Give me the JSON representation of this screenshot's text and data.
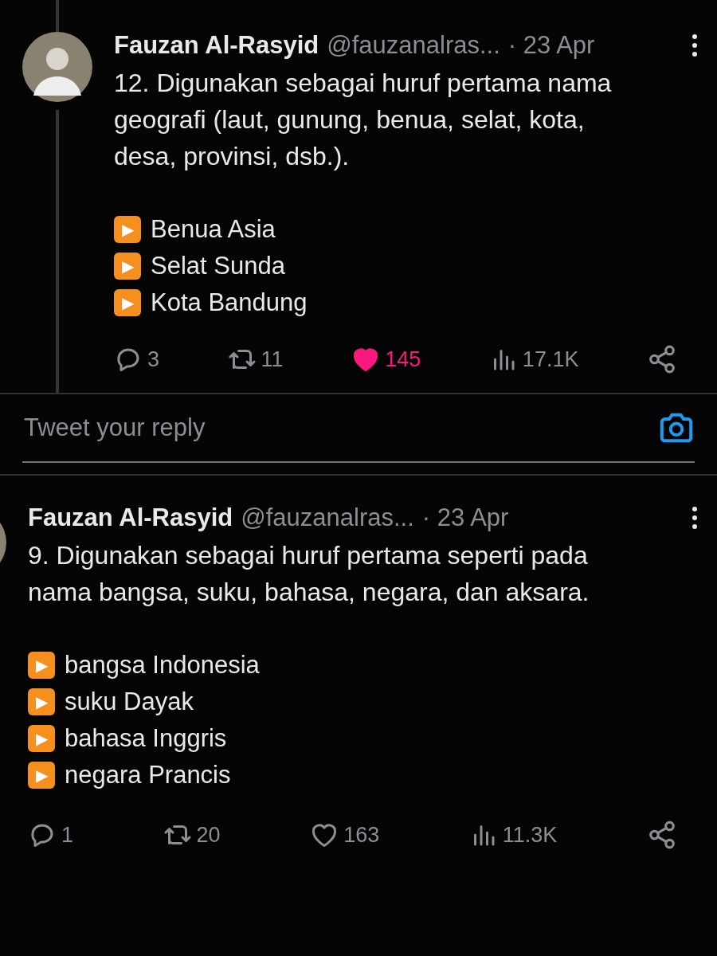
{
  "tweets": [
    {
      "name": "Fauzan Al-Rasyid",
      "handle": "@fauzanalras...",
      "time": "· 23 Apr",
      "thread": true,
      "body": "12. Digunakan sebagai huruf pertama nama geografi (laut, gunung, benua, selat, kota, desa, provinsi, dsb.).",
      "examples": [
        {
          "marker": "▶",
          "text": "Benua Asia"
        },
        {
          "marker": "▶",
          "text": "Selat Sunda"
        },
        {
          "marker": "▶",
          "text": "Kota Bandung"
        }
      ],
      "replies": "3",
      "retweets": "11",
      "likes": "145",
      "liked": true,
      "views": "17.1K"
    },
    {
      "name": "Fauzan Al-Rasyid",
      "handle": "@fauzanalras...",
      "time": "· 23 Apr",
      "thread": false,
      "body": "9. Digunakan sebagai huruf pertama seperti pada nama bangsa, suku, bahasa, negara, dan aksara.",
      "examples": [
        {
          "marker": "▶",
          "text": "bangsa Indonesia"
        },
        {
          "marker": "▶",
          "text": "suku Dayak"
        },
        {
          "marker": "▶",
          "text": "bahasa Inggris"
        },
        {
          "marker": "▶",
          "text": "negara Prancis"
        }
      ],
      "replies": "1",
      "retweets": "20",
      "likes": "163",
      "liked": false,
      "views": "11.3K"
    }
  ],
  "reply": {
    "placeholder": "Tweet your reply"
  }
}
